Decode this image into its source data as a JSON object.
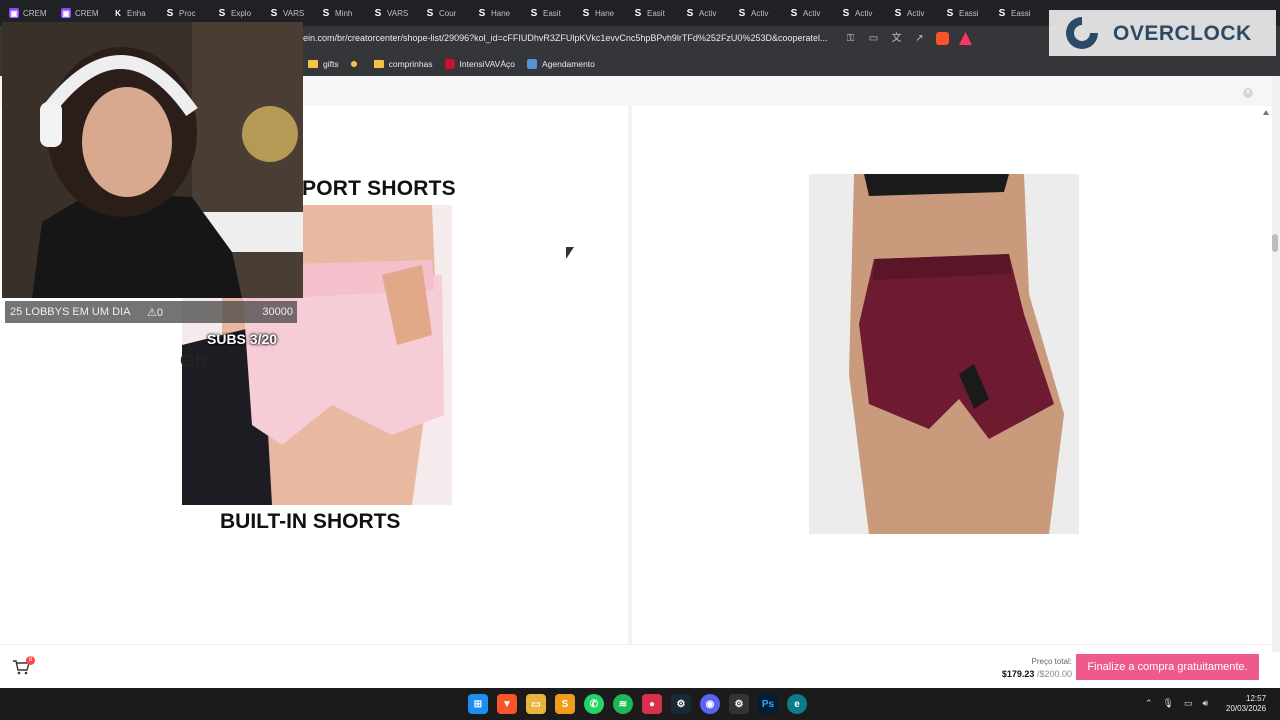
{
  "tabs": [
    {
      "icon": "twitch-icon",
      "label": "CREM"
    },
    {
      "icon": "twitch-icon",
      "label": "CREM"
    },
    {
      "icon": "k-icon",
      "label": "Enha"
    },
    {
      "icon": "s-icon",
      "label": "Proc"
    },
    {
      "icon": "s-icon",
      "label": "Explo"
    },
    {
      "icon": "s-icon",
      "label": "VARS"
    },
    {
      "icon": "s-icon",
      "label": "Minh"
    },
    {
      "icon": "s-icon",
      "label": "VARS"
    },
    {
      "icon": "s-icon",
      "label": "Cour"
    },
    {
      "icon": "s-icon",
      "label": "Hane"
    },
    {
      "icon": "s-icon",
      "label": "Easit"
    },
    {
      "icon": "s-icon",
      "label": "Hane"
    },
    {
      "icon": "s-icon",
      "label": "Easit"
    },
    {
      "icon": "s-icon",
      "label": "Activ"
    },
    {
      "icon": "s-icon",
      "label": "Activ"
    },
    {
      "icon": "s-icon",
      "label": "Activ"
    },
    {
      "icon": "s-icon",
      "label": "Activ"
    },
    {
      "icon": "s-icon",
      "label": "Activ"
    },
    {
      "icon": "s-icon",
      "label": "Eassi"
    },
    {
      "icon": "s-icon",
      "label": "Eassi"
    }
  ],
  "address": {
    "url": "ein.com/br/creatorcenter/shope-list/29096?kol_id=cFFIUDhvR3ZFUlpKVkc1evvCnc5hpBPvh9lrTFd%252FzU0%253D&cooperatel..."
  },
  "bookmarks": [
    {
      "label": "gifts",
      "icon": "folder-icon"
    },
    {
      "label": "",
      "icon": "dot-icon"
    },
    {
      "label": "comprinhas",
      "icon": "folder-icon"
    },
    {
      "label": "IntensiVAVÁço",
      "icon": "bookmark-icon"
    },
    {
      "label": "Agendamento",
      "icon": "calendar-icon"
    }
  ],
  "products": {
    "left_title": "PORT SHORTS",
    "left_caption": "BUILT-IN SHORTS",
    "right_alt": "Burgundy high-waist shorts"
  },
  "checkout": {
    "cart_count": "8",
    "total_label": "Preço total:",
    "total_value": "$179.23",
    "total_limit": "/$200.00",
    "button_label": "Finalize a compra gratuitamente."
  },
  "stream": {
    "goal_text": "25 LOBBYS EM UM DIA",
    "goal_count": "0",
    "goal_target": "30000",
    "subs_text": "SUBS 3/20",
    "partial_text": "ON",
    "brand": "OVERCLOCK"
  },
  "taskbar": {
    "time": "12:57",
    "date": "20/03/2026"
  },
  "colors": {
    "accent": "#ee5a8c",
    "burgundy": "#6e1b32"
  }
}
